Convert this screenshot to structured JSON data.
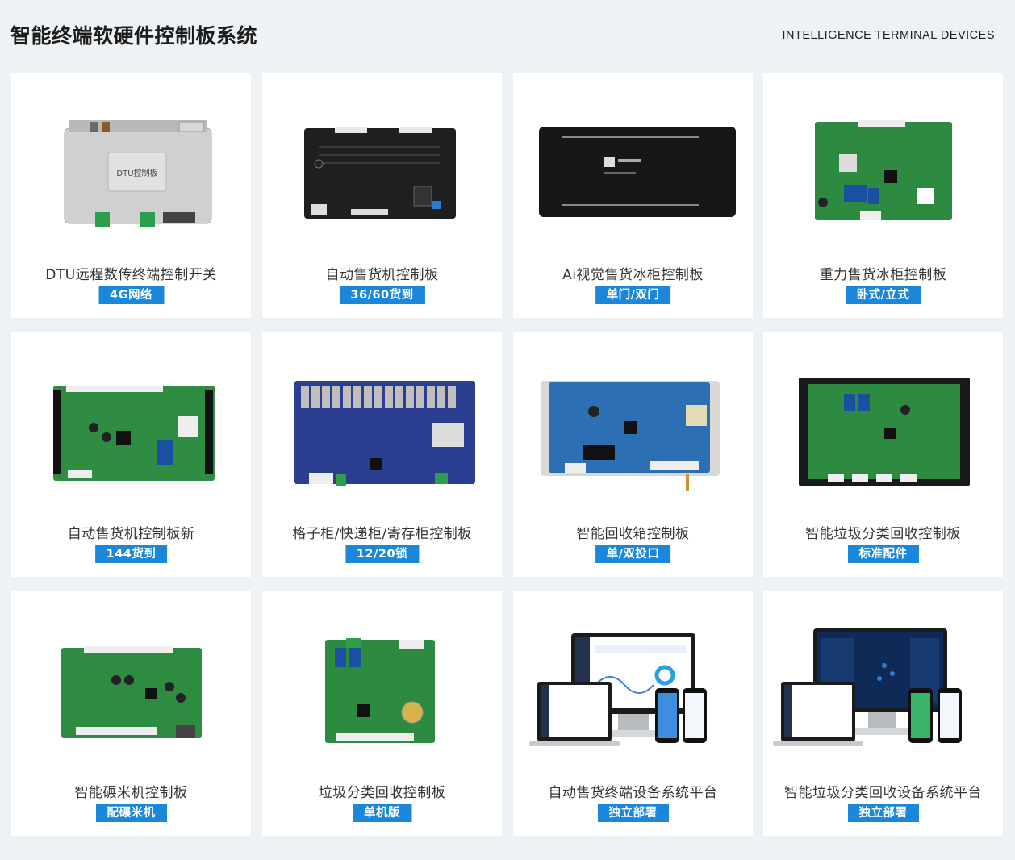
{
  "header": {
    "title": "智能终端软硬件控制板系统",
    "subtitle": "INTELLIGENCE TERMINAL DEVICES"
  },
  "colors": {
    "accent": "#1b87da",
    "background": "#eef2f5",
    "card": "#ffffff"
  },
  "products": [
    {
      "name": "DTU远程数传终端控制开关",
      "tag": "4G网络",
      "image_text": "DTU控制板"
    },
    {
      "name": "自动售货机控制板",
      "tag": "36/60货到"
    },
    {
      "name": "Ai视觉售货冰柜控制板",
      "tag": "单门/双门"
    },
    {
      "name": "重力售货冰柜控制板",
      "tag": "卧式/立式"
    },
    {
      "name": "自动售货机控制板新",
      "tag": "144货到"
    },
    {
      "name": "格子柜/快递柜/寄存柜控制板",
      "tag": "12/20锁"
    },
    {
      "name": "智能回收箱控制板",
      "tag": "单/双投口"
    },
    {
      "name": "智能垃圾分类回收控制板",
      "tag": "标准配件"
    },
    {
      "name": "智能碾米机控制板",
      "tag": "配碾米机"
    },
    {
      "name": "垃圾分类回收控制板",
      "tag": "单机版"
    },
    {
      "name": "自动售货终端设备系统平台",
      "tag": "独立部署"
    },
    {
      "name": "智能垃圾分类回收设备系统平台",
      "tag": "独立部署"
    }
  ]
}
